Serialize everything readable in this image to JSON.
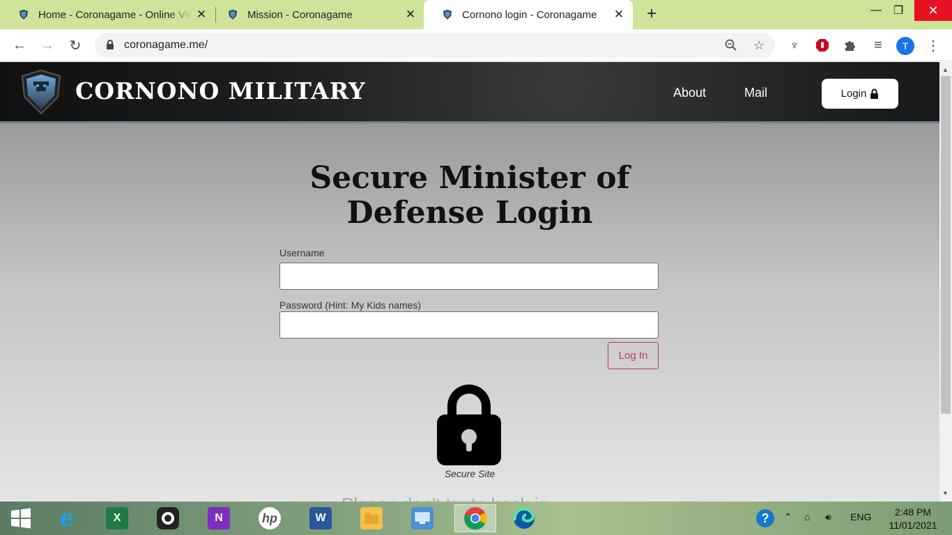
{
  "browser": {
    "tabs": [
      {
        "title": "Home - Coronagame - Online Vir"
      },
      {
        "title": "Mission - Coronagame"
      },
      {
        "title": "Cornono login - Coronagame"
      }
    ],
    "url": "coronagame.me/",
    "profile_initial": "T"
  },
  "site": {
    "title": "CORNONO MILITARY",
    "nav": {
      "about": "About",
      "mail": "Mail",
      "login": "Login"
    }
  },
  "login": {
    "heading": "Secure Minister of Defense Login",
    "username_label": "Username",
    "username_value": "",
    "password_label": "Password (Hint: My Kids names)",
    "password_value": "",
    "submit_label": "Log In",
    "secure_caption": "Secure Site",
    "cutoff_text": "Please don't try to hack in"
  },
  "taskbar": {
    "language": "ENG",
    "time": "2:48 PM",
    "date": "11/01/2021",
    "apps": [
      "start-icon",
      "internet-explorer-icon",
      "excel-icon",
      "camera-app-icon",
      "onenote-icon",
      "hp-icon",
      "word-icon",
      "file-explorer-icon",
      "remote-desktop-icon",
      "chrome-icon",
      "edge-icon"
    ]
  },
  "colors": {
    "tab_strip": "#cfe39a",
    "accent_button": "#c0395a",
    "site_header": "#1c1c1c"
  }
}
